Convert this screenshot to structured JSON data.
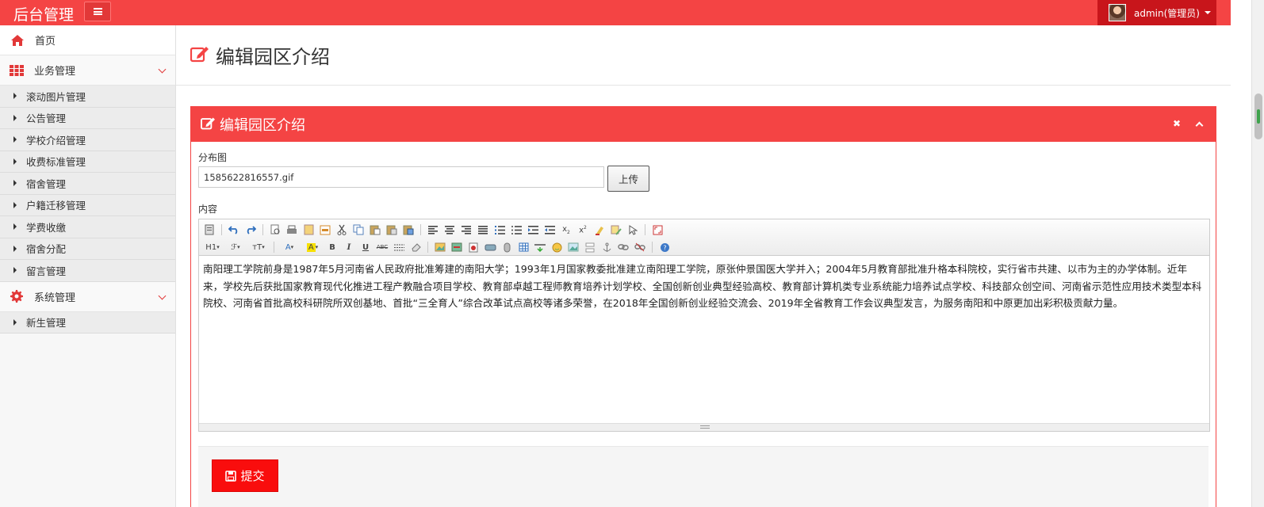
{
  "app": {
    "brand": "后台管理",
    "user_label": "admin(管理员)",
    "accent_color": "#f44444"
  },
  "sidebar": {
    "home": {
      "label": "首页",
      "icon": "home-icon"
    },
    "groups": [
      {
        "label": "业务管理",
        "icon": "grid-icon",
        "items": [
          "滚动图片管理",
          "公告管理",
          "学校介绍管理",
          "收费标准管理",
          "宿舍管理",
          "户籍迁移管理",
          "学费收缴",
          "宿舍分配",
          "留言管理"
        ]
      },
      {
        "label": "系统管理",
        "icon": "gear-icon",
        "items": [
          "新生管理"
        ]
      }
    ]
  },
  "page": {
    "title": "编辑园区介绍"
  },
  "panel": {
    "title": "编辑园区介绍",
    "distribution_label": "分布图",
    "file_value": "1585622816557.gif",
    "upload_label": "上传",
    "content_label": "内容",
    "content_text": "南阳理工学院前身是1987年5月河南省人民政府批准筹建的南阳大学；1993年1月国家教委批准建立南阳理工学院，原张仲景国医大学并入；2004年5月教育部批准升格本科院校，实行省市共建、以市为主的办学体制。近年来，学校先后获批国家教育现代化推进工程产教融合项目学校、教育部卓越工程师教育培养计划学校、全国创新创业典型经验高校、教育部计算机类专业系统能力培养试点学校、科技部众创空间、河南省示范性应用技术类型本科院校、河南省首批高校科研院所双创基地、首批“三全育人”综合改革试点高校等诸多荣誉，在2018年全国创新创业经验交流会、2019年全省教育工作会议典型发言，为服务南阳和中原更加出彩积极贡献力量。",
    "submit_label": "提交",
    "toolbar": {
      "heading_label": "H1",
      "font_label": "ℱ",
      "size_label": "тT",
      "fontcolor_label": "A",
      "bgcolor_label": "A",
      "bold_label": "B",
      "italic_label": "I",
      "underline_label": "U",
      "strike_label": "ABC"
    }
  }
}
